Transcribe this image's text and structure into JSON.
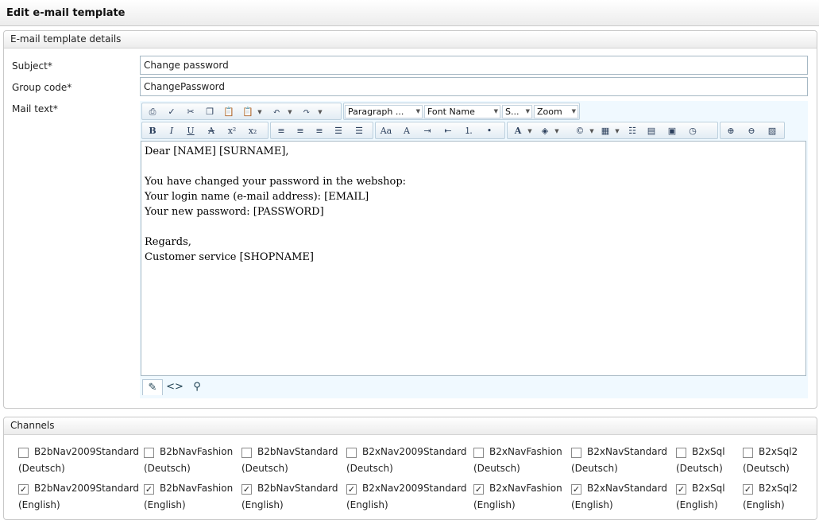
{
  "page": {
    "title": "Edit e-mail template"
  },
  "details": {
    "heading": "E-mail template details",
    "subject_label": "Subject*",
    "subject_value": "Change password",
    "group_code_label": "Group code*",
    "group_code_value": "ChangePassword",
    "mail_text_label": "Mail text*"
  },
  "editor": {
    "paragraph_select": "Paragraph ...",
    "font_select": "Font Name",
    "size_select": "S...",
    "zoom_select": "Zoom",
    "lines": [
      "Dear [NAME] [SURNAME],",
      "",
      "You have changed your password in the webshop:",
      "Your login name (e-mail address): [EMAIL]",
      "Your new password: [PASSWORD]",
      "",
      "Regards,",
      "Customer service [SHOPNAME]"
    ],
    "format_labels": {
      "bold": "B",
      "italic": "I",
      "underline": "U",
      "strike": "A",
      "superscript": "x²",
      "subscript": "x₂"
    }
  },
  "channels": {
    "heading": "Channels",
    "items": [
      {
        "name": "B2bNav2009Standard",
        "deutsch_checked": false,
        "english_checked": true
      },
      {
        "name": "B2bNavFashion",
        "deutsch_checked": false,
        "english_checked": true
      },
      {
        "name": "B2bNavStandard",
        "deutsch_checked": false,
        "english_checked": true
      },
      {
        "name": "B2xNav2009Standard",
        "deutsch_checked": false,
        "english_checked": true
      },
      {
        "name": "B2xNavFashion",
        "deutsch_checked": false,
        "english_checked": true
      },
      {
        "name": "B2xNavStandard",
        "deutsch_checked": false,
        "english_checked": true
      },
      {
        "name": "B2xSql",
        "deutsch_checked": false,
        "english_checked": true
      },
      {
        "name": "B2xSql2",
        "deutsch_checked": false,
        "english_checked": true
      }
    ],
    "lang_deutsch": "(Deutsch)",
    "lang_english": "(English)"
  },
  "colors": {
    "editor_bg": "#f0f9ff",
    "border": "#a6b8c4"
  }
}
